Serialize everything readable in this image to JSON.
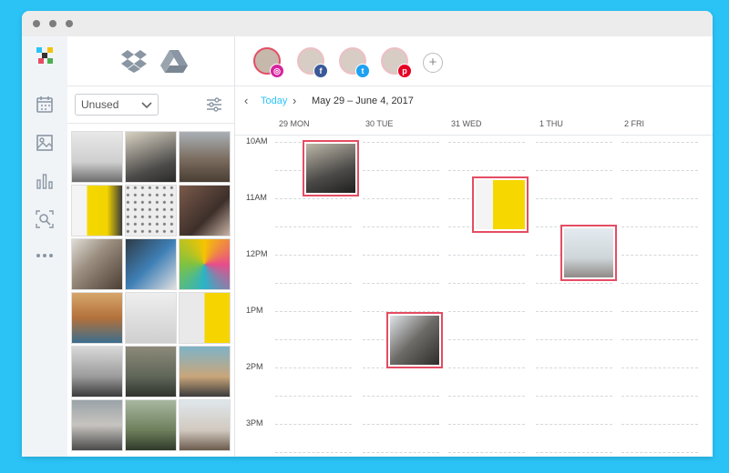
{
  "window": {
    "controls": [
      "close",
      "minimize",
      "maximize"
    ]
  },
  "sidebar": {
    "logo": "app-logo-icon",
    "items": [
      {
        "name": "calendar-icon"
      },
      {
        "name": "image-icon"
      },
      {
        "name": "analytics-icon"
      },
      {
        "name": "search-icon"
      },
      {
        "name": "more-icon"
      }
    ]
  },
  "library": {
    "sources": [
      "dropbox-icon",
      "google-drive-icon"
    ],
    "filter": {
      "selected": "Unused"
    },
    "settings_icon": "sliders-icon"
  },
  "accounts": [
    {
      "network": "instagram",
      "badge_color": "#d6249f"
    },
    {
      "network": "facebook",
      "badge_color": "#3b5998"
    },
    {
      "network": "twitter",
      "badge_color": "#1da1f2"
    },
    {
      "network": "pinterest",
      "badge_color": "#e60023"
    }
  ],
  "calendar": {
    "today_label": "Today",
    "range": "May 29 – June 4, 2017",
    "days": [
      "29 MON",
      "30 TUE",
      "31 WED",
      "1 THU",
      "2 FRI"
    ],
    "hours": [
      "10AM",
      "11AM",
      "12PM",
      "1PM",
      "2PM",
      "3PM"
    ]
  },
  "colors": {
    "accent": "#2bc3f6",
    "event_border": "#e44d63"
  }
}
